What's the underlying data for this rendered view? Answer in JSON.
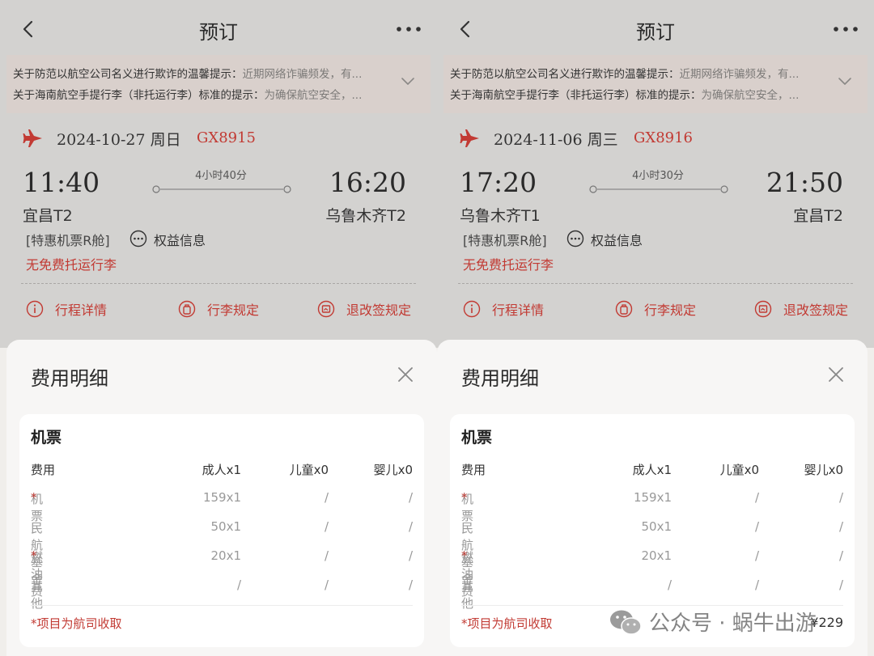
{
  "screens": [
    {
      "nav_title": "预订",
      "notices": [
        {
          "bold": "关于防范以航空公司名义进行欺诈的温馨提示：",
          "text": "近期网络诈骗频发，有..."
        },
        {
          "bold": "关于海南航空手提行李（非托运行李）标准的提示：",
          "text": "为确保航空安全，..."
        }
      ],
      "date": "2024-10-27 周日",
      "flight_no": "GX8915",
      "dep_time": "11:40",
      "arr_time": "16:20",
      "duration": "4小时40分",
      "dep_airport": "宜昌T2",
      "arr_airport": "乌鲁木齐T2",
      "cabin": "[特惠机票R舱]",
      "rights": "权益信息",
      "baggage": "无免费托运行李",
      "actions": [
        "行程详情",
        "行李规定",
        "退改签规定"
      ],
      "sheet_title": "费用明细",
      "card_title": "机票",
      "headers": [
        "费用",
        "成人x1",
        "儿童x0",
        "婴儿x0"
      ],
      "rows": [
        {
          "name": "机票",
          "star": "*",
          "adult": "159x1",
          "child": "/",
          "infant": "/"
        },
        {
          "name": "民航基金",
          "star": "",
          "adult": "50x1",
          "child": "/",
          "infant": "/"
        },
        {
          "name": "燃油费",
          "star": "*",
          "adult": "20x1",
          "child": "/",
          "infant": "/"
        },
        {
          "name": "其他",
          "star": "",
          "adult": "/",
          "child": "/",
          "infant": "/"
        }
      ],
      "note": "*项目为航司收取",
      "total": ""
    },
    {
      "nav_title": "预订",
      "notices": [
        {
          "bold": "关于防范以航空公司名义进行欺诈的温馨提示：",
          "text": "近期网络诈骗频发，有..."
        },
        {
          "bold": "关于海南航空手提行李（非托运行李）标准的提示：",
          "text": "为确保航空安全，..."
        }
      ],
      "date": "2024-11-06 周三",
      "flight_no": "GX8916",
      "dep_time": "17:20",
      "arr_time": "21:50",
      "duration": "4小时30分",
      "dep_airport": "乌鲁木齐T1",
      "arr_airport": "宜昌T2",
      "cabin": "[特惠机票R舱]",
      "rights": "权益信息",
      "baggage": "无免费托运行李",
      "actions": [
        "行程详情",
        "行李规定",
        "退改签规定"
      ],
      "sheet_title": "费用明细",
      "card_title": "机票",
      "headers": [
        "费用",
        "成人x1",
        "儿童x0",
        "婴儿x0"
      ],
      "rows": [
        {
          "name": "机票",
          "star": "*",
          "adult": "159x1",
          "child": "/",
          "infant": "/"
        },
        {
          "name": "民航基金",
          "star": "",
          "adult": "50x1",
          "child": "/",
          "infant": "/"
        },
        {
          "name": "燃油费",
          "star": "*",
          "adult": "20x1",
          "child": "/",
          "infant": "/"
        },
        {
          "name": "其他",
          "star": "",
          "adult": "/",
          "child": "/",
          "infant": "/"
        }
      ],
      "note": "*项目为航司收取",
      "total": "¥229"
    }
  ],
  "watermark": "公众号 · 蜗牛出游",
  "colors": {
    "accent": "#c23a33",
    "overlay": "#d3d2d0",
    "sheet": "#f7f6f5"
  },
  "icons": [
    "back-icon",
    "more-icon",
    "chevron-down-icon",
    "plane-icon",
    "rights-icon",
    "info-icon",
    "luggage-icon",
    "ticket-icon",
    "close-icon",
    "wechat-icon"
  ]
}
